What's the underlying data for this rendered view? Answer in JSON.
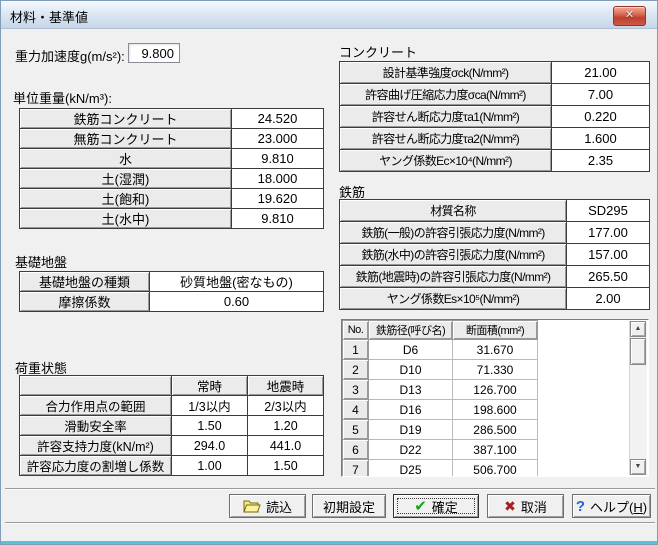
{
  "window": {
    "title": "材料・基準値"
  },
  "icons": {
    "close": "✕",
    "scroll_up": "▲",
    "scroll_down": "▼",
    "check": "✔",
    "cross": "✖",
    "help": "?"
  },
  "gravity": {
    "label": "重力加速度g(m/s²):",
    "value": "9.800"
  },
  "unit_weight": {
    "section_label": "単位重量(kN/m³):",
    "rows": [
      {
        "label": "鉄筋コンクリート",
        "value": "24.520"
      },
      {
        "label": "無筋コンクリート",
        "value": "23.000"
      },
      {
        "label": "水",
        "value": "9.810"
      },
      {
        "label": "土(湿潤)",
        "value": "18.000"
      },
      {
        "label": "土(飽和)",
        "value": "19.620"
      },
      {
        "label": "土(水中)",
        "value": "9.810"
      }
    ]
  },
  "foundation": {
    "section_label": "基礎地盤",
    "rows": [
      {
        "label": "基礎地盤の種類",
        "value": "砂質地盤(密なもの)"
      },
      {
        "label": "摩擦係数",
        "value": "0.60"
      }
    ]
  },
  "load_state": {
    "section_label": "荷重状態",
    "col_headers": {
      "normal": "常時",
      "quake": "地震時"
    },
    "rows": [
      {
        "label": "合力作用点の範囲",
        "normal": "1/3以内",
        "quake": "2/3以内"
      },
      {
        "label": "滑動安全率",
        "normal": "1.50",
        "quake": "1.20"
      },
      {
        "label": "許容支持力度(kN/m²)",
        "normal": "294.0",
        "quake": "441.0"
      },
      {
        "label": "許容応力度の割増し係数",
        "normal": "1.00",
        "quake": "1.50"
      }
    ]
  },
  "concrete": {
    "section_label": "コンクリート",
    "rows": [
      {
        "label": "設計基準強度σck(N/mm²)",
        "value": "21.00"
      },
      {
        "label": "許容曲げ圧縮応力度σca(N/mm²)",
        "value": "7.00"
      },
      {
        "label": "許容せん断応力度τa1(N/mm²)",
        "value": "0.220"
      },
      {
        "label": "許容せん断応力度τa2(N/mm²)",
        "value": "1.600"
      },
      {
        "label": "ヤング係数Ec×10⁴(N/mm²)",
        "value": "2.35"
      }
    ]
  },
  "rebar": {
    "section_label": "鉄筋",
    "rows": [
      {
        "label": "材質名称",
        "value": "SD295"
      },
      {
        "label": "鉄筋(一般)の許容引張応力度(N/mm²)",
        "value": "177.00"
      },
      {
        "label": "鉄筋(水中)の許容引張応力度(N/mm²)",
        "value": "157.00"
      },
      {
        "label": "鉄筋(地震時)の許容引張応力度(N/mm²)",
        "value": "265.50"
      },
      {
        "label": "ヤング係数Es×10⁵(N/mm²)",
        "value": "2.00"
      }
    ]
  },
  "rebar_sizes": {
    "headers": {
      "no": "No.",
      "name": "鉄筋径(呼び名)",
      "area": "断面積(mm²)"
    },
    "rows": [
      {
        "no": "1",
        "name": "D6",
        "area": "31.670"
      },
      {
        "no": "2",
        "name": "D10",
        "area": "71.330"
      },
      {
        "no": "3",
        "name": "D13",
        "area": "126.700"
      },
      {
        "no": "4",
        "name": "D16",
        "area": "198.600"
      },
      {
        "no": "5",
        "name": "D19",
        "area": "286.500"
      },
      {
        "no": "6",
        "name": "D22",
        "area": "387.100"
      },
      {
        "no": "7",
        "name": "D25",
        "area": "506.700"
      }
    ]
  },
  "buttons": {
    "load": "読込",
    "init": "初期設定",
    "confirm": "確定",
    "cancel": "取消",
    "help_pre": "ヘルプ(",
    "help_key": "H",
    "help_post": ")"
  },
  "colors": {
    "titlebar": "#d8e3f0",
    "close_red": "#c14130",
    "check_green": "#17a317",
    "cross_red": "#a81d1d",
    "help_blue": "#1e63d6",
    "frame_cyan": "#55c3da"
  }
}
